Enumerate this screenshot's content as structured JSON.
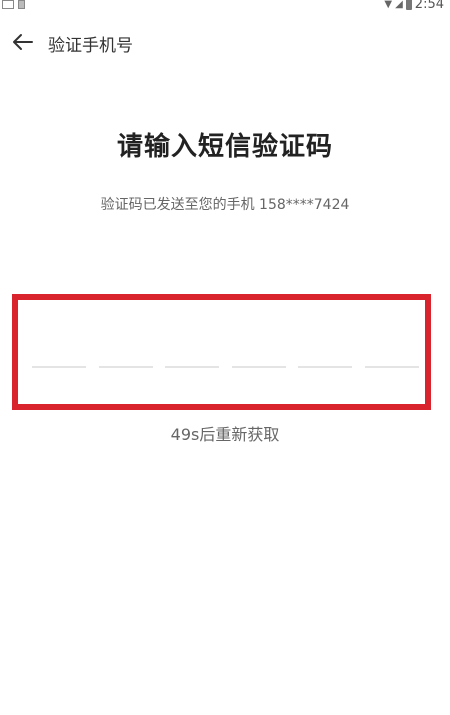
{
  "status_bar": {
    "time": "2:54"
  },
  "nav": {
    "title": "验证手机号"
  },
  "main": {
    "headline": "请输入短信验证码",
    "subtitle": "验证码已发送至您的手机 158****7424",
    "resend": "49s后重新获取",
    "code_digits": 6
  },
  "colors": {
    "highlight_border": "#d9232d"
  }
}
